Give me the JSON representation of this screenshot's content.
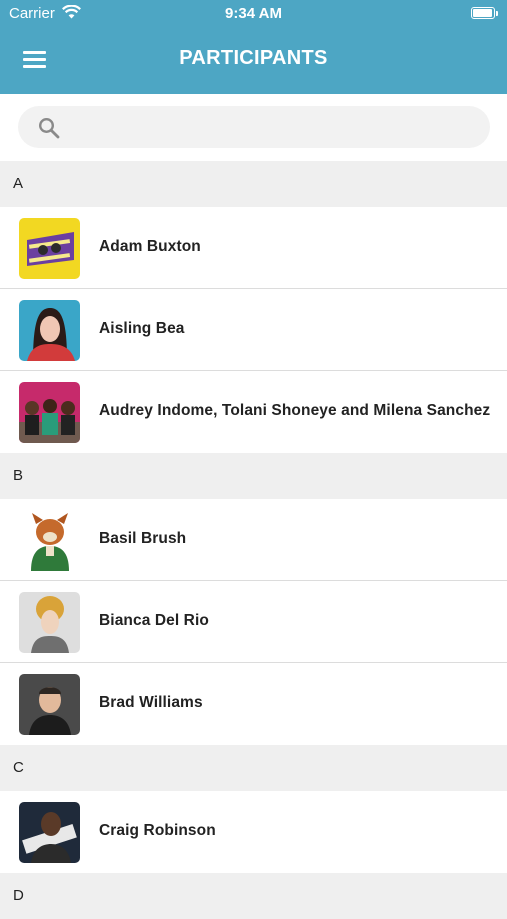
{
  "status": {
    "carrier": "Carrier",
    "time": "9:34 AM"
  },
  "header": {
    "title": "PARTICIPANTS"
  },
  "search": {
    "placeholder": ""
  },
  "sections": [
    {
      "letter": "A",
      "participants": [
        {
          "name": "Adam Buxton"
        },
        {
          "name": "Aisling Bea"
        },
        {
          "name": "Audrey Indome, Tolani Shoneye and Milena Sanchez"
        }
      ]
    },
    {
      "letter": "B",
      "participants": [
        {
          "name": "Basil Brush"
        },
        {
          "name": "Bianca Del Rio"
        },
        {
          "name": "Brad Williams"
        }
      ]
    },
    {
      "letter": "C",
      "participants": [
        {
          "name": "Craig Robinson"
        }
      ]
    },
    {
      "letter": "D",
      "participants": []
    }
  ],
  "colors": {
    "header": "#4da6c4",
    "section_bg": "#efefef"
  }
}
